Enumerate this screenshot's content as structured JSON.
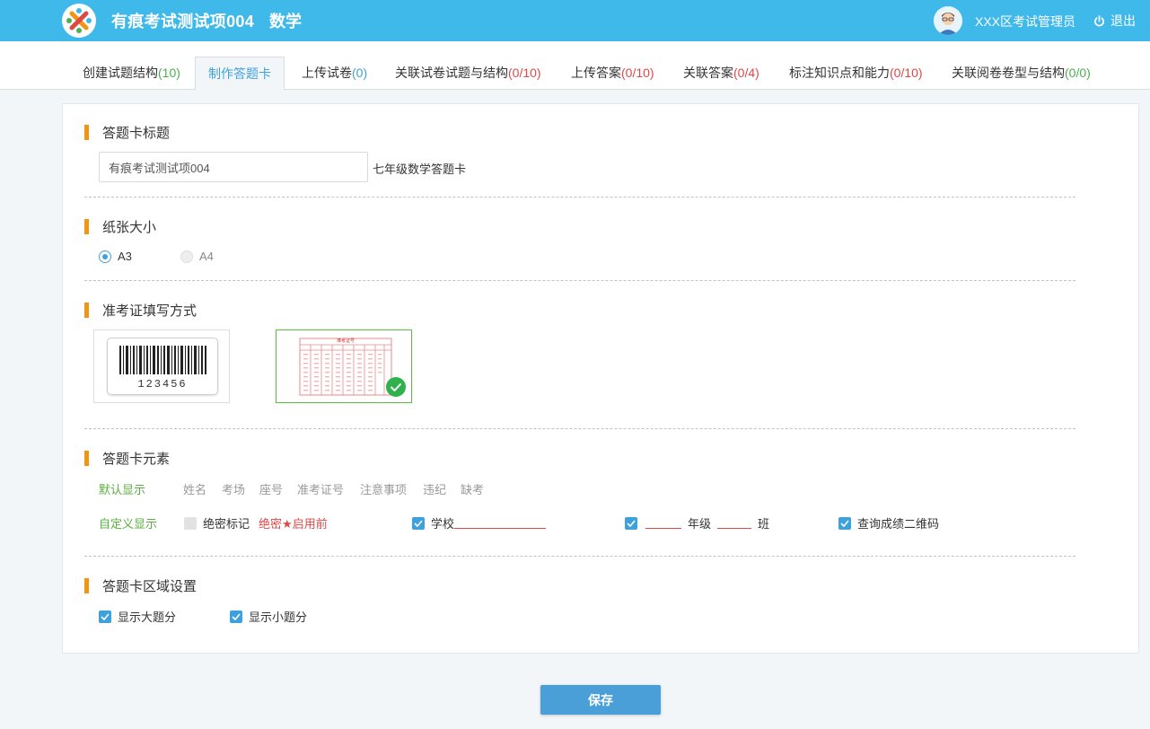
{
  "header": {
    "title": "有痕考试测试项004",
    "subject": "数学",
    "user_name": "XXX区考试管理员",
    "logout_label": "退出",
    "bg_color": "#3fb8ea"
  },
  "tabs": [
    {
      "label": "创建试题结构",
      "count": "(10)"
    },
    {
      "label": "制作答题卡",
      "count": ""
    },
    {
      "label": "上传试卷",
      "count": "(0)"
    },
    {
      "label": "关联试卷试题与结构",
      "count": "(0/10)"
    },
    {
      "label": "上传答案",
      "count": "(0/10)"
    },
    {
      "label": "关联答案",
      "count": "(0/4)"
    },
    {
      "label": "标注知识点和能力",
      "count": "(0/10)"
    },
    {
      "label": "关联阅卷卷型与结构",
      "count": "(0/0)"
    }
  ],
  "card_title": {
    "heading": "答题卡标题",
    "input_value": "有痕考试测试项004",
    "suffix": "七年级数学答题卡"
  },
  "paper_size": {
    "heading": "纸张大小",
    "options": [
      {
        "label": "A3",
        "selected": true
      },
      {
        "label": "A4",
        "selected": false
      }
    ]
  },
  "admission": {
    "heading": "准考证填写方式",
    "barcode_number": "123456",
    "grid_title": "准考证号",
    "selected": "grid"
  },
  "elements": {
    "heading": "答题卡元素",
    "default_label": "默认显示",
    "default_items": [
      "姓名",
      "考场",
      "座号",
      "准考证号",
      "注意事项",
      "违纪",
      "缺考"
    ],
    "custom_label": "自定义显示",
    "custom": {
      "secret_label": "绝密标记",
      "secret_tag_pre": "绝密",
      "secret_tag_post": "启用前",
      "school_label": "学校",
      "grade_label": "年级",
      "class_label": "班",
      "qr_label": "查询成绩二维码"
    }
  },
  "region": {
    "heading": "答题卡区域设置",
    "show_big_score": "显示大题分",
    "show_small_score": "显示小题分"
  },
  "save_label": "保存"
}
